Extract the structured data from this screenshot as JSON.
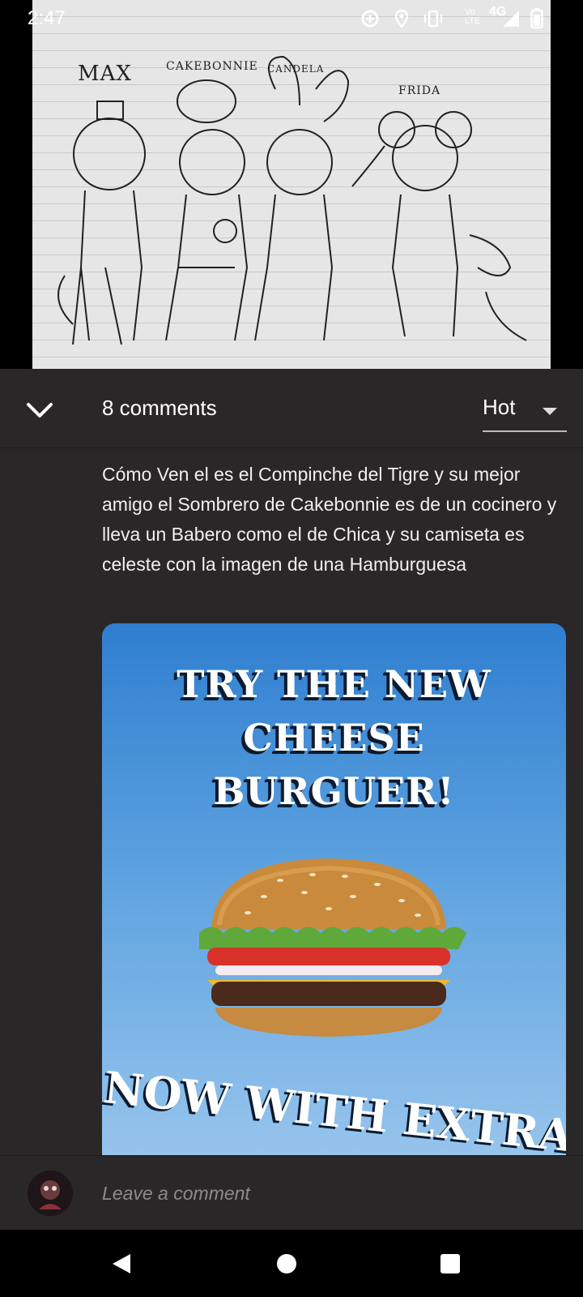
{
  "status_bar": {
    "time": "2:47",
    "volte_line1": "Vo",
    "volte_line2": "LTE",
    "network": "4G",
    "icons": [
      "data-saver-icon",
      "location-icon",
      "vibrate-icon",
      "signal-icon",
      "battery-icon"
    ]
  },
  "drawing": {
    "labels": [
      "MAX",
      "CAKEBONNIE",
      "CANDELA",
      "FRIDA"
    ]
  },
  "header": {
    "collapse_icon": "chevron-down-icon",
    "comments_count_label": "8 comments",
    "sort": {
      "selected": "Hot"
    }
  },
  "comment": {
    "text": "Cómo Ven el es el Compinche del Tigre y su mejor amigo el Sombrero de Cakebonnie es de un cocinero y lleva un Babero como el de Chica y su camiseta es celeste con la imagen de una Hamburguesa",
    "image": {
      "headline_lines": [
        "TRY THE NEW",
        "CHEESE",
        "BURGUER!"
      ],
      "bottom_text": "NOW WITH EXTRA"
    }
  },
  "compose": {
    "placeholder": "Leave a comment"
  },
  "nav": {
    "icons": [
      "back-icon",
      "home-icon",
      "recents-icon"
    ]
  },
  "colors": {
    "panel_bg": "#2a2729",
    "poster_top": "#2f7ed0",
    "poster_bottom": "#9ec8ee"
  }
}
